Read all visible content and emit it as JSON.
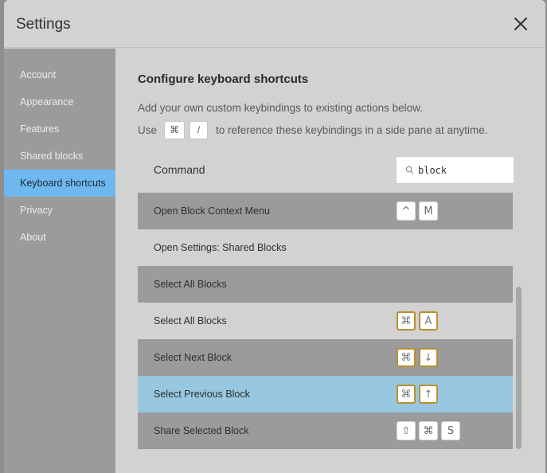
{
  "modal": {
    "title": "Settings",
    "close_icon": "close-icon"
  },
  "sidebar": {
    "items": [
      {
        "label": "Account",
        "active": false
      },
      {
        "label": "Appearance",
        "active": false
      },
      {
        "label": "Features",
        "active": false
      },
      {
        "label": "Shared blocks",
        "active": false
      },
      {
        "label": "Keyboard shortcuts",
        "active": true
      },
      {
        "label": "Privacy",
        "active": false
      },
      {
        "label": "About",
        "active": false
      }
    ]
  },
  "content": {
    "heading": "Configure keyboard shortcuts",
    "description_line1": "Add your own custom keybindings to existing actions below.",
    "description_use": "Use",
    "description_key1": "⌘",
    "description_key2": "/",
    "description_rest": "to reference these keybindings in a side pane at anytime.",
    "column_header": "Command",
    "search": {
      "value": "block",
      "icon": "search-icon"
    }
  },
  "shortcuts": [
    {
      "command": "Open Block Context Menu",
      "keys": [
        "^",
        "M"
      ],
      "style": "plain"
    },
    {
      "command": "Open Settings: Shared Blocks",
      "keys": [],
      "style": "plain"
    },
    {
      "command": "Select All Blocks",
      "keys": [],
      "style": "plain"
    },
    {
      "command": "Select All Blocks",
      "keys": [
        "⌘",
        "A"
      ],
      "style": "gold"
    },
    {
      "command": "Select Next Block",
      "keys": [
        "⌘",
        "↓"
      ],
      "style": "gold"
    },
    {
      "command": "Select Previous Block",
      "keys": [
        "⌘",
        "↑"
      ],
      "style": "gold"
    },
    {
      "command": "Share Selected Block",
      "keys": [
        "⇧",
        "⌘",
        "S"
      ],
      "style": "plain"
    }
  ],
  "colors": {
    "active_sidebar": "#6fb8ef",
    "selected_row": "#98c7e0",
    "conflict_key_border": "#b8902c"
  }
}
